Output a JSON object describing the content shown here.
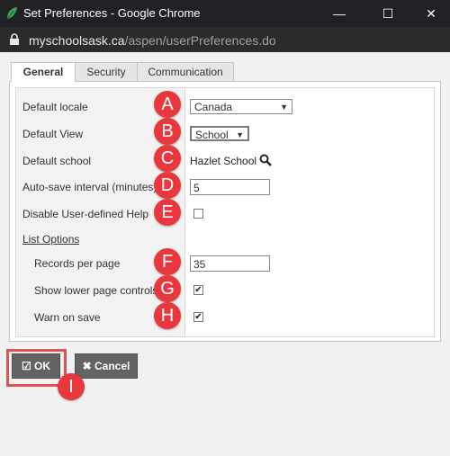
{
  "window": {
    "title": "Set Preferences - Google Chrome",
    "url_host": "myschoolsask.ca",
    "url_path": "/aspen/userPreferences.do"
  },
  "tabs": [
    "General",
    "Security",
    "Communication"
  ],
  "form": {
    "default_locale": {
      "label": "Default locale",
      "value": "Canada",
      "marker": "A"
    },
    "default_view": {
      "label": "Default View",
      "value": "School",
      "marker": "B"
    },
    "default_school": {
      "label": "Default school",
      "value": "Hazlet School",
      "marker": "C"
    },
    "autosave": {
      "label": "Auto-save interval (minutes)",
      "value": "5",
      "marker": "D"
    },
    "disable_help": {
      "label": "Disable User-defined Help",
      "checked": false,
      "marker": "E"
    },
    "list_options": {
      "label": "List Options"
    },
    "records_per_page": {
      "label": "Records per page",
      "value": "35",
      "marker": "F"
    },
    "show_lower_controls": {
      "label": "Show lower page controls",
      "checked": true,
      "marker": "G"
    },
    "warn_on_save": {
      "label": "Warn on save",
      "checked": true,
      "marker": "H"
    }
  },
  "buttons": {
    "ok": {
      "label": "OK",
      "marker": "I"
    },
    "cancel": {
      "label": "Cancel"
    }
  },
  "colors": {
    "marker": "#e8373d",
    "highlight": "#e2524e",
    "button": "#636363"
  },
  "icons": [
    "leaf-icon",
    "minimize-icon",
    "maximize-icon",
    "close-icon",
    "lock-icon",
    "search-icon",
    "checkmark-icon",
    "x-icon"
  ]
}
